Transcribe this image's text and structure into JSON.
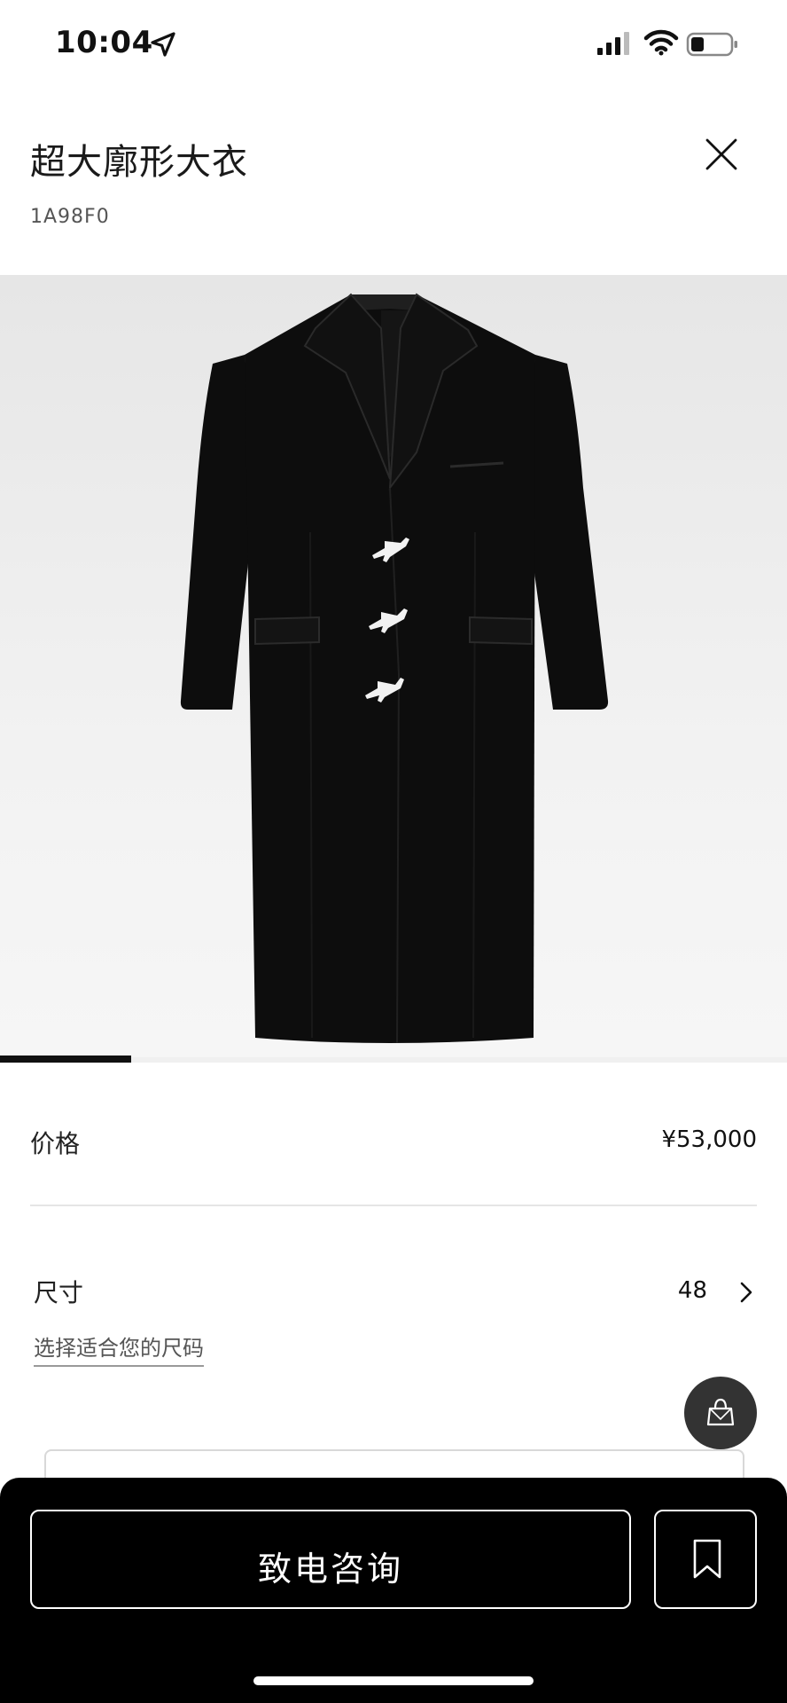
{
  "status_bar": {
    "time": "10:04",
    "icons": [
      "location-arrow-icon",
      "cellular-signal-icon",
      "wifi-icon",
      "battery-icon"
    ]
  },
  "header": {
    "title": "超大廓形大衣",
    "sku": "1A98F0",
    "close_icon": "close-icon"
  },
  "product_image": {
    "description_icon": "product-photo",
    "carousel_total_pages": 6,
    "carousel_current_page": 1
  },
  "details": {
    "price_label": "价格",
    "price_value": "¥53,000",
    "size_label": "尺寸",
    "size_value": "48",
    "size_guide_link": "选择适合您的尺码"
  },
  "fab": {
    "icon": "shopping-bag-icon"
  },
  "bottom_bar": {
    "contact_button_label": "致电咨询",
    "bookmark_icon": "bookmark-icon"
  },
  "colors": {
    "background": "#ffffff",
    "bottom_bar": "#000000",
    "fab": "#333333",
    "coat": "#0d0d0d",
    "buttons": "#f2f2f2"
  }
}
